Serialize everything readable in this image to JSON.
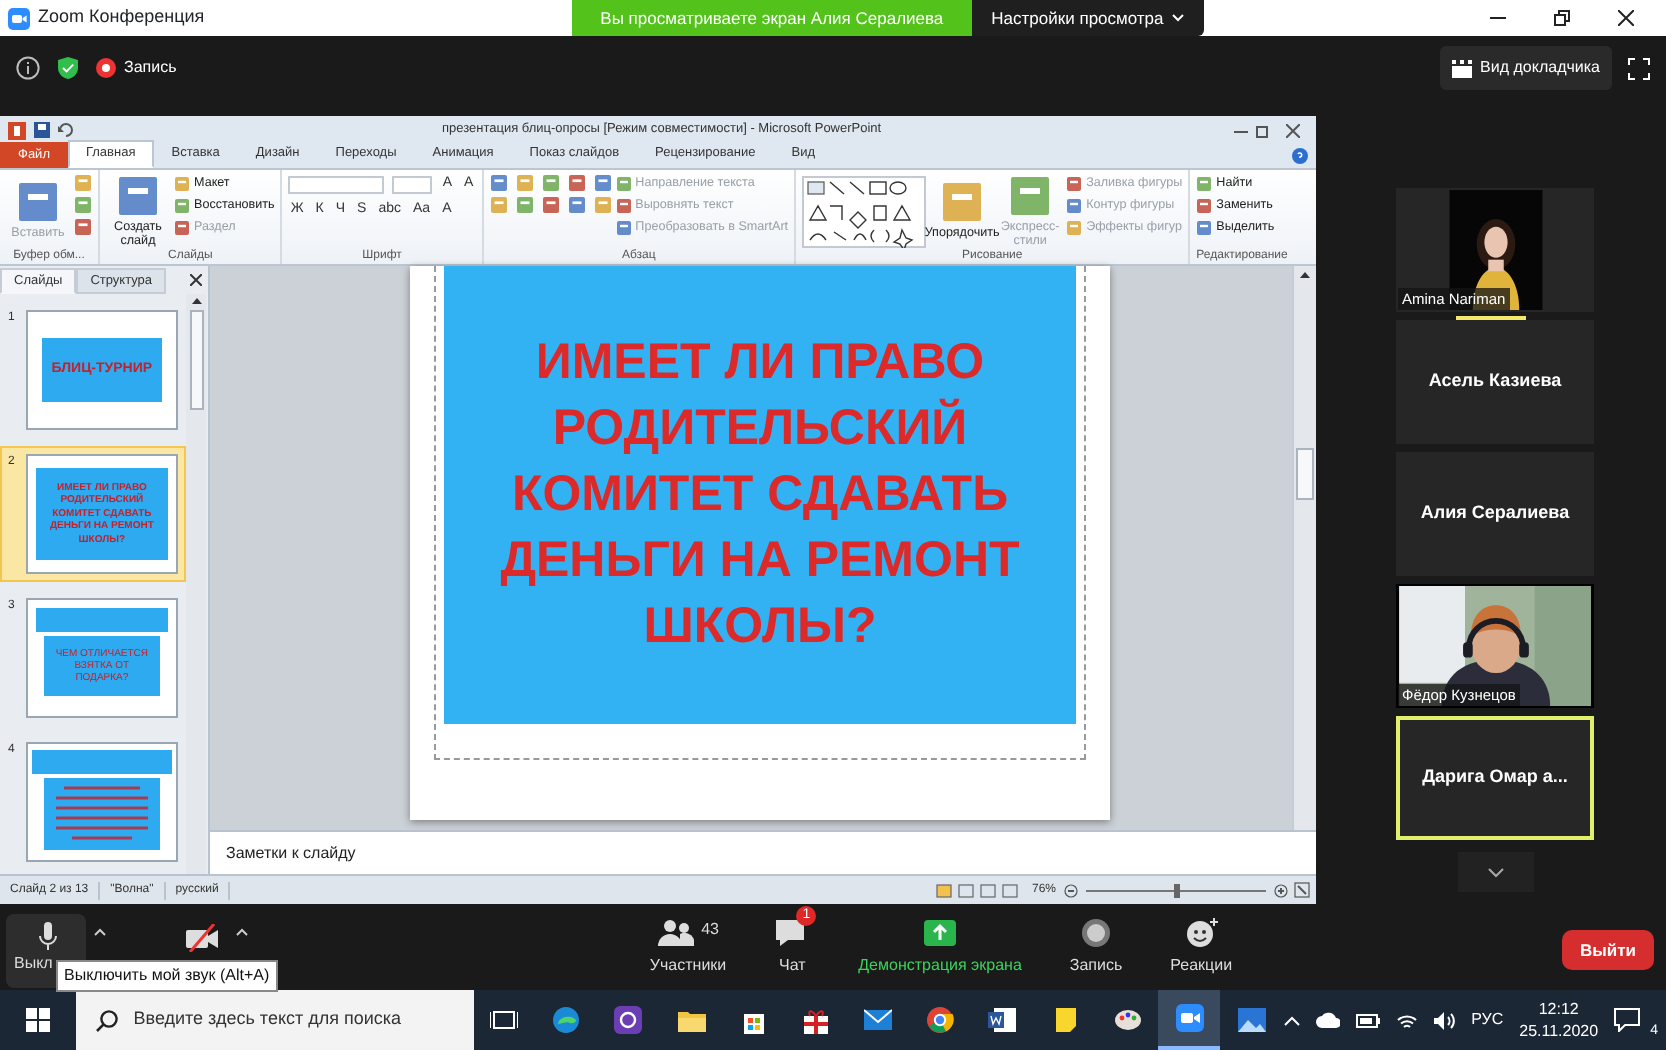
{
  "window": {
    "title": "Zoom Конференция"
  },
  "share_banner": {
    "text": "Вы просматриваете экран Алия Сералиева",
    "options": "Настройки просмотра"
  },
  "top_bar": {
    "recording": "Запись",
    "view_button": "Вид докладчика"
  },
  "powerpoint": {
    "title": "презентация блиц-опросы [Режим совместимости] - Microsoft PowerPoint",
    "file_tab": "Файл",
    "tabs": [
      {
        "label": "Главная",
        "selected": true
      },
      {
        "label": "Вставка",
        "selected": false
      },
      {
        "label": "Дизайн",
        "selected": false
      },
      {
        "label": "Переходы",
        "selected": false
      },
      {
        "label": "Анимация",
        "selected": false
      },
      {
        "label": "Показ слайдов",
        "selected": false
      },
      {
        "label": "Рецензирование",
        "selected": false
      },
      {
        "label": "Вид",
        "selected": false
      }
    ],
    "ribbon": [
      {
        "title": "Буфер обм...",
        "columns": [
          [
            {
              "kind": "large",
              "label": "Вставить",
              "disabled": true
            }
          ],
          [
            {
              "kind": "icon"
            },
            {
              "kind": "icon"
            },
            {
              "kind": "icon"
            }
          ]
        ]
      },
      {
        "title": "Слайды",
        "columns": [
          [
            {
              "kind": "large",
              "label": "Создать слайд",
              "disabled": false
            }
          ],
          [
            {
              "kind": "small",
              "label": "Макет",
              "disabled": false
            },
            {
              "kind": "small",
              "label": "Восстановить",
              "disabled": false
            },
            {
              "kind": "small",
              "label": "Раздел",
              "disabled": true
            }
          ]
        ]
      },
      {
        "title": "Шрифт",
        "columns": [
          [
            {
              "kind": "row",
              "items": [
                {
                  "kind": "font-combo"
                },
                {
                  "kind": "size-combo"
                },
                {
                  "kind": "glyph",
                  "label": "A"
                },
                {
                  "kind": "glyph",
                  "label": "A"
                }
              ]
            },
            {
              "kind": "row",
              "items": [
                {
                  "kind": "glyph",
                  "label": "Ж"
                },
                {
                  "kind": "glyph",
                  "label": "К"
                },
                {
                  "kind": "glyph",
                  "label": "Ч"
                },
                {
                  "kind": "glyph",
                  "label": "S"
                },
                {
                  "kind": "glyph",
                  "label": "abc"
                },
                {
                  "kind": "glyph",
                  "label": "Aa"
                },
                {
                  "kind": "glyph",
                  "label": "A"
                }
              ]
            }
          ]
        ]
      },
      {
        "title": "Абзац",
        "columns": [
          [
            {
              "kind": "row",
              "items": [
                {
                  "kind": "icon"
                },
                {
                  "kind": "icon"
                },
                {
                  "kind": "icon"
                },
                {
                  "kind": "icon"
                },
                {
                  "kind": "icon"
                }
              ]
            },
            {
              "kind": "row",
              "items": [
                {
                  "kind": "icon"
                },
                {
                  "kind": "icon"
                },
                {
                  "kind": "icon"
                },
                {
                  "kind": "icon"
                },
                {
                  "kind": "icon"
                }
              ]
            }
          ],
          [
            {
              "kind": "small",
              "label": "Направление текста",
              "disabled": true
            },
            {
              "kind": "small",
              "label": "Выровнять текст",
              "disabled": true
            },
            {
              "kind": "small",
              "label": "Преобразовать в SmartArt",
              "disabled": true
            }
          ]
        ]
      },
      {
        "title": "Рисование",
        "columns": [
          [
            {
              "kind": "gallery"
            }
          ],
          [
            {
              "kind": "large",
              "label": "Упорядочить",
              "disabled": false
            }
          ],
          [
            {
              "kind": "large",
              "label": "Экспресс-стили",
              "disabled": true
            }
          ],
          [
            {
              "kind": "small",
              "label": "Заливка фигуры",
              "disabled": true
            },
            {
              "kind": "small",
              "label": "Контур фигуры",
              "disabled": true
            },
            {
              "kind": "small",
              "label": "Эффекты фигур",
              "disabled": true
            }
          ]
        ]
      },
      {
        "title": "Редактирование",
        "columns": [
          [
            {
              "kind": "small",
              "label": "Найти",
              "disabled": false
            },
            {
              "kind": "small",
              "label": "Заменить",
              "disabled": false
            },
            {
              "kind": "small",
              "label": "Выделить",
              "disabled": false
            }
          ]
        ]
      }
    ],
    "pane_tabs": [
      {
        "label": "Слайды",
        "selected": true
      },
      {
        "label": "Структура",
        "selected": false
      }
    ],
    "thumbnails": [
      {
        "number": "1",
        "kind": "title",
        "text": "БЛИЦ-ТУРНИР",
        "selected": false
      },
      {
        "number": "2",
        "kind": "full",
        "text": "ИМЕЕТ ЛИ ПРАВО РОДИТЕЛЬСКИЙ КОМИТЕТ СДАВАТЬ ДЕНЬГИ НА РЕМОНТ ШКОЛЫ?",
        "selected": true
      },
      {
        "number": "3",
        "kind": "band",
        "text": "ЧЕМ ОТЛИЧАЕТСЯ ВЗЯТКА ОТ ПОДАРКА?",
        "selected": false
      },
      {
        "number": "4",
        "kind": "band-lines",
        "selected": false
      }
    ],
    "slide": {
      "text": "ИМЕЕТ ЛИ ПРАВО\nРОДИТЕЛЬСКИЙ\nКОМИТЕТ СДАВАТЬ\nДЕНЬГИ НА РЕМОНТ\nШКОЛЫ?"
    },
    "notes_placeholder": "Заметки к слайду",
    "status": [
      "Слайд 2 из 13",
      "\"Волна\"",
      "русский"
    ],
    "zoom": {
      "reading": "76%",
      "level": 0.5
    }
  },
  "participants": [
    {
      "name": "Amina Nariman",
      "video": true,
      "speaking": true,
      "active": false
    },
    {
      "name": "Асель Казиева",
      "video": false,
      "speaking": false,
      "active": false
    },
    {
      "name": "Алия Сералиева",
      "video": false,
      "speaking": false,
      "active": false
    },
    {
      "name": "Фёдор Кузнецов",
      "video": true,
      "speaking": false,
      "active": false
    },
    {
      "name": "Дарига Омар а...",
      "video": false,
      "speaking": false,
      "active": true
    }
  ],
  "toolbar": {
    "mic": {
      "label": "Выкл",
      "muted": false
    },
    "video": {
      "on": false
    },
    "tooltip": "Выключить мой звук (Alt+A)",
    "center": [
      {
        "kind": "participants",
        "label": "Участники",
        "count": "43"
      },
      {
        "kind": "chat",
        "label": "Чат",
        "badge": "1"
      },
      {
        "kind": "share",
        "label": "Демонстрация экрана"
      },
      {
        "kind": "record",
        "label": "Запись"
      },
      {
        "kind": "reactions",
        "label": "Реакции"
      }
    ],
    "leave": "Выйти"
  },
  "taskbar": {
    "search_placeholder": "Введите здесь текст для поиска",
    "apps": [
      {
        "selected": false
      },
      {
        "selected": false
      },
      {
        "selected": false
      },
      {
        "selected": false
      },
      {
        "selected": false
      },
      {
        "selected": false
      },
      {
        "selected": false
      },
      {
        "selected": false
      },
      {
        "selected": false
      },
      {
        "selected": false
      },
      {
        "selected": true
      },
      {
        "selected": false
      }
    ],
    "language": "РУС",
    "time": "12:12",
    "date": "25.11.2020",
    "notifications": "4"
  }
}
